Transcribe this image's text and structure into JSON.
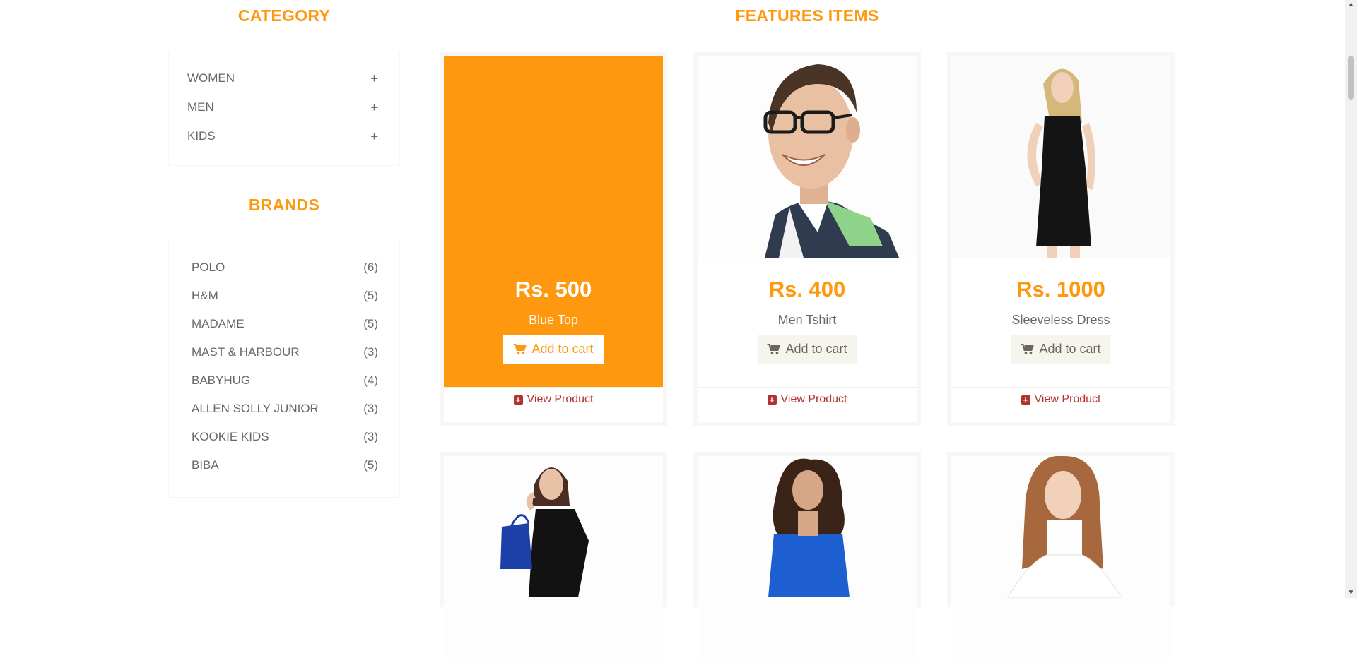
{
  "category": {
    "title": "CATEGORY",
    "items": [
      {
        "label": "WOMEN",
        "icon": "plus-icon",
        "icon_glyph": "+"
      },
      {
        "label": "MEN",
        "icon": "plus-icon",
        "icon_glyph": "+"
      },
      {
        "label": "KIDS",
        "icon": "plus-icon",
        "icon_glyph": "+"
      }
    ]
  },
  "brands": {
    "title": "BRANDS",
    "items": [
      {
        "name": "POLO",
        "count": "(6)"
      },
      {
        "name": "H&M",
        "count": "(5)"
      },
      {
        "name": "MADAME",
        "count": "(5)"
      },
      {
        "name": "MAST & HARBOUR",
        "count": "(3)"
      },
      {
        "name": "BABYHUG",
        "count": "(4)"
      },
      {
        "name": "ALLEN SOLLY JUNIOR",
        "count": "(3)"
      },
      {
        "name": "KOOKIE KIDS",
        "count": "(3)"
      },
      {
        "name": "BIBA",
        "count": "(5)"
      }
    ]
  },
  "features": {
    "title": "FEATURES ITEMS",
    "products": [
      {
        "price": "Rs. 500",
        "name": "Blue Top",
        "add_to_cart": "Add to cart",
        "view": "View Product",
        "hovered": true,
        "image": "blue-top-photo"
      },
      {
        "price": "Rs. 400",
        "name": "Men Tshirt",
        "add_to_cart": "Add to cart",
        "view": "View Product",
        "hovered": false,
        "image": "man-glasses-photo"
      },
      {
        "price": "Rs. 1000",
        "name": "Sleeveless Dress",
        "add_to_cart": "Add to cart",
        "view": "View Product",
        "hovered": false,
        "image": "woman-black-dress-photo"
      },
      {
        "image": "woman-shopping-bag-photo"
      },
      {
        "image": "woman-blue-top-photo"
      },
      {
        "image": "girl-white-tshirt-photo"
      }
    ]
  },
  "colors": {
    "accent": "#FE980F",
    "link": "#B3312E",
    "text": "#696763",
    "button_bg": "#F5F5ED"
  }
}
